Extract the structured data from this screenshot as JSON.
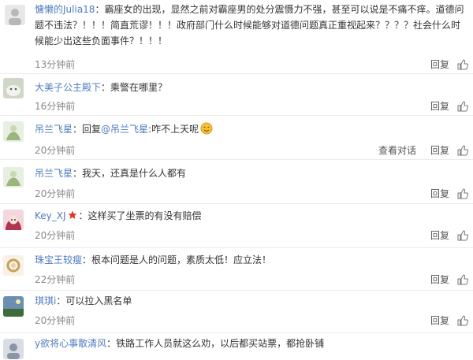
{
  "comments": [
    {
      "username": "慵懒的Julia18",
      "separator": "：",
      "text": "霸座女的出现，显然之前对霸座男的处分震慑力不强，甚至可以说是不痛不痒。道德问题不违法？！！！简直荒谬！！！政府部门什么时候能够对道德问题真正重视起来？？？？社会什么时候能少出这些负面事件？！！！",
      "time": "13分钟前",
      "reply_label": "回复"
    },
    {
      "username": "大美子公主殿下",
      "separator": "：",
      "text": "乘警在哪里？",
      "time": "16分钟前",
      "reply_label": "回复"
    },
    {
      "username": "吊兰飞星",
      "separator": "：",
      "reply_prefix": "回复",
      "mention": "@吊兰飞星",
      "text": ":咋不上天呢",
      "time": "20分钟前",
      "view_conversation_label": "查看对话",
      "reply_label": "回复"
    },
    {
      "username": "吊兰飞星",
      "separator": "：",
      "text": "我天，还真是什么人都有",
      "time": "20分钟前",
      "reply_label": "回复"
    },
    {
      "username": "Key_XJ",
      "separator": "：",
      "text": "这样买了坐票的有没有赔偿",
      "time": "20分钟前",
      "reply_label": "回复"
    },
    {
      "username": "珠宝王较瘦",
      "separator": "：",
      "text": "根本问题是人的问题，素质太低！应立法！",
      "time": "22分钟前",
      "reply_label": "回复"
    },
    {
      "username": "琪琪i",
      "separator": "：",
      "text": "可以拉入黑名单",
      "time": "20分钟前",
      "reply_label": "回复"
    },
    {
      "username": "y欲将心事散清风",
      "separator": "：",
      "text": "铁路工作人员就这么劝，以后都买站票，都抢卧铺",
      "time": "",
      "reply_label": ""
    }
  ],
  "colors": {
    "username": "#4f7dbf",
    "text": "#333333",
    "meta": "#888888",
    "vip_badge": "#e0332a"
  }
}
